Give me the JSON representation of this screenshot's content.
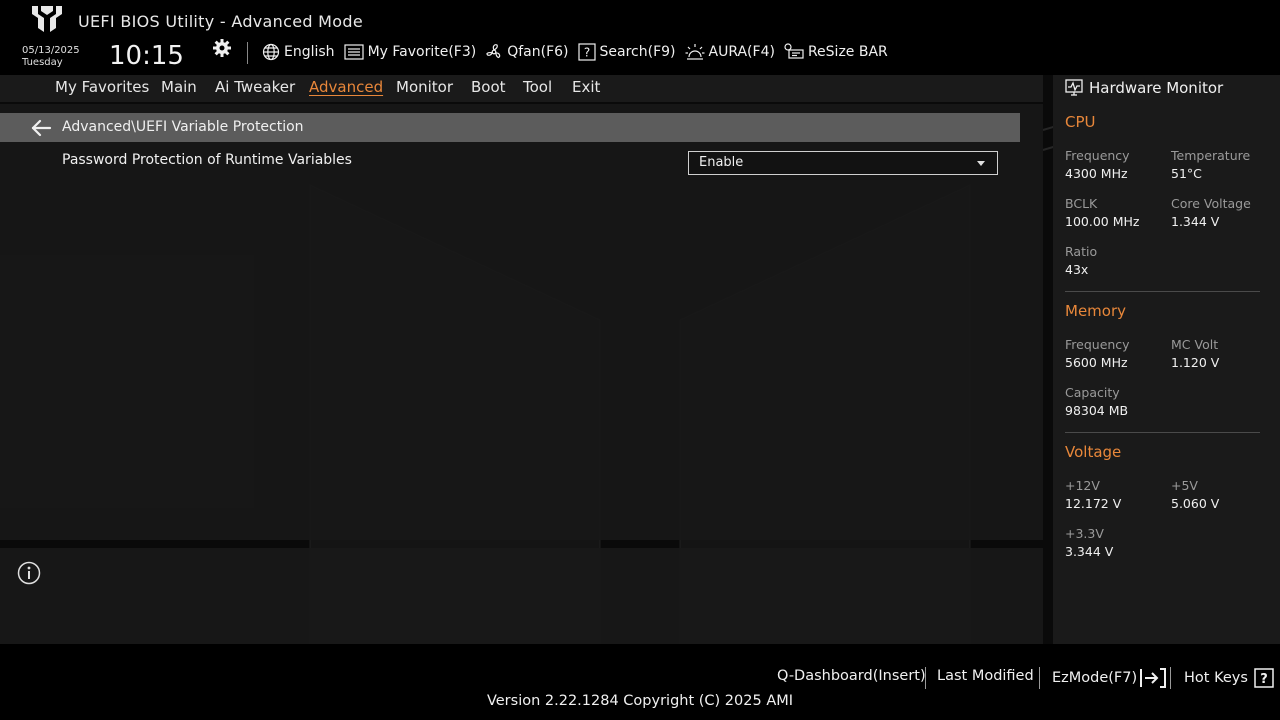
{
  "header": {
    "title": "UEFI BIOS Utility - Advanced Mode",
    "date": "05/13/2025",
    "day": "Tuesday",
    "time": "10:15",
    "toolbar": {
      "language": "English",
      "my_favorite": "My Favorite(F3)",
      "qfan": "Qfan(F6)",
      "search": "Search(F9)",
      "aura": "AURA(F4)",
      "resize_bar": "ReSize BAR"
    }
  },
  "nav": {
    "tabs": [
      "My Favorites",
      "Main",
      "Ai Tweaker",
      "Advanced",
      "Monitor",
      "Boot",
      "Tool",
      "Exit"
    ],
    "active": "Advanced"
  },
  "main": {
    "breadcrumb": "Advanced\\UEFI Variable Protection",
    "settings": [
      {
        "label": "Password Protection of Runtime Variables",
        "value": "Enable"
      }
    ]
  },
  "hardware_monitor": {
    "title": "Hardware Monitor",
    "cpu": {
      "title": "CPU",
      "frequency_label": "Frequency",
      "frequency": "4300 MHz",
      "temperature_label": "Temperature",
      "temperature": "51°C",
      "bclk_label": "BCLK",
      "bclk": "100.00 MHz",
      "core_voltage_label": "Core Voltage",
      "core_voltage": "1.344 V",
      "ratio_label": "Ratio",
      "ratio": "43x"
    },
    "memory": {
      "title": "Memory",
      "frequency_label": "Frequency",
      "frequency": "5600 MHz",
      "mc_volt_label": "MC Volt",
      "mc_volt": "1.120 V",
      "capacity_label": "Capacity",
      "capacity": "98304 MB"
    },
    "voltage": {
      "title": "Voltage",
      "v12_label": "+12V",
      "v12": "12.172 V",
      "v5_label": "+5V",
      "v5": "5.060 V",
      "v33_label": "+3.3V",
      "v33": "3.344 V"
    }
  },
  "footer": {
    "q_dashboard": "Q-Dashboard(Insert)",
    "last_modified": "Last Modified",
    "ezmode": "EzMode(F7)",
    "hot_keys": "Hot Keys",
    "version": "Version 2.22.1284 Copyright (C) 2025 AMI"
  },
  "colors": {
    "accent": "#e8873a",
    "panel": "#1a1a1a",
    "breadcrumb_bar": "#5c5c5c"
  }
}
